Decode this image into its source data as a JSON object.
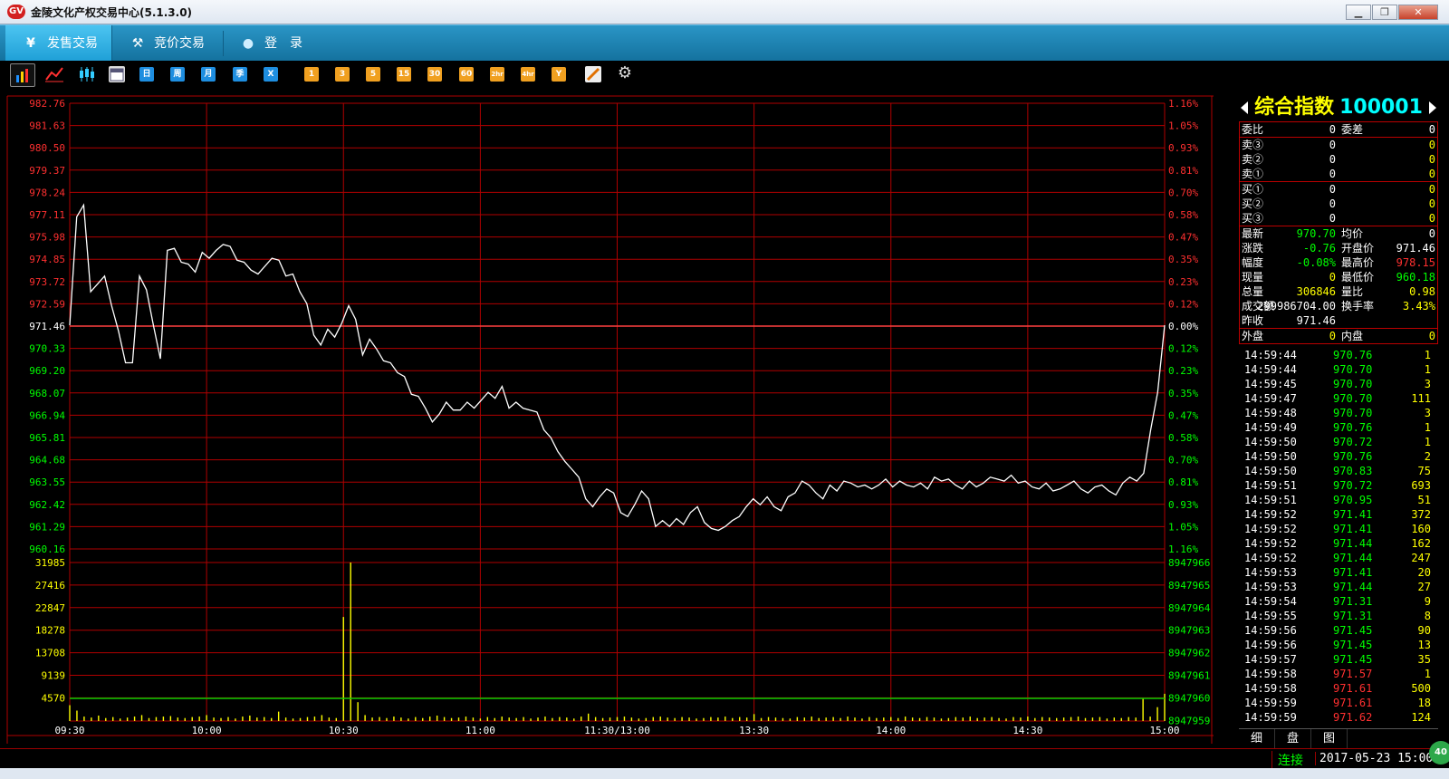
{
  "window": {
    "title": "金陵文化产权交易中心(5.1.3.0)",
    "logo": "GV",
    "min": "▁",
    "max": "❐",
    "close": "✕"
  },
  "nav": {
    "tabs": [
      {
        "label": "发售交易",
        "icon": "yen-icon",
        "glyph": "¥"
      },
      {
        "label": "竞价交易",
        "icon": "gavel-icon",
        "glyph": "⚒"
      },
      {
        "label": "登　录",
        "icon": "user-icon",
        "glyph": "●"
      }
    ]
  },
  "toolbar": {
    "period_buttons": [
      "日",
      "周",
      "月",
      "季",
      "X"
    ],
    "minute_buttons": [
      "1",
      "3",
      "5",
      "15",
      "30",
      "60",
      "2hr",
      "4hr",
      "Y"
    ]
  },
  "chart_data": {
    "type": "line",
    "price_axis_left": [
      "982.76",
      "981.63",
      "980.50",
      "979.37",
      "978.24",
      "977.11",
      "975.98",
      "974.85",
      "973.72",
      "972.59",
      "971.46",
      "970.33",
      "969.20",
      "968.07",
      "966.94",
      "965.81",
      "964.68",
      "963.55",
      "962.42",
      "961.29",
      "960.16"
    ],
    "pct_axis_right": [
      "1.16%",
      "1.05%",
      "0.93%",
      "0.81%",
      "0.70%",
      "0.58%",
      "0.47%",
      "0.35%",
      "0.23%",
      "0.12%",
      "0.00%",
      "0.12%",
      "0.23%",
      "0.35%",
      "0.47%",
      "0.58%",
      "0.70%",
      "0.81%",
      "0.93%",
      "1.05%",
      "1.16%"
    ],
    "prev_close": 971.46,
    "ylim": [
      960.16,
      982.76
    ],
    "volume_axis_left": [
      "31985",
      "27416",
      "22847",
      "18278",
      "13708",
      "9139",
      "4570"
    ],
    "volume_axis_right": [
      "8947966",
      "8947965",
      "8947964",
      "8947963",
      "8947962",
      "8947961",
      "8947960",
      "8947959"
    ],
    "vol_max": 31985,
    "vol_ref": 4570,
    "time_labels": [
      "09:30",
      "10:00",
      "10:30",
      "11:00",
      "11:30/13:00",
      "13:30",
      "14:00",
      "14:30",
      "15:00"
    ],
    "price_series": [
      971.5,
      977.0,
      977.6,
      973.2,
      973.6,
      974.0,
      972.5,
      971.2,
      969.6,
      969.6,
      974.0,
      973.3,
      971.5,
      969.8,
      975.3,
      975.4,
      974.7,
      974.6,
      974.2,
      975.2,
      974.9,
      975.3,
      975.6,
      975.5,
      974.8,
      974.7,
      974.3,
      974.1,
      974.5,
      974.9,
      974.8,
      974.0,
      974.1,
      973.2,
      972.6,
      971.0,
      970.5,
      971.3,
      970.9,
      971.6,
      972.5,
      971.8,
      970.0,
      970.8,
      970.3,
      969.7,
      969.6,
      969.1,
      968.9,
      968.0,
      967.9,
      967.3,
      966.6,
      967.0,
      967.6,
      967.2,
      967.2,
      967.6,
      967.3,
      967.7,
      968.1,
      967.8,
      968.4,
      967.3,
      967.6,
      967.3,
      967.2,
      967.1,
      966.2,
      965.8,
      965.1,
      964.6,
      964.2,
      963.8,
      962.7,
      962.3,
      962.8,
      963.2,
      963.0,
      962.0,
      961.8,
      962.4,
      963.1,
      962.7,
      961.3,
      961.6,
      961.3,
      961.7,
      961.4,
      962.0,
      962.3,
      961.5,
      961.2,
      961.1,
      961.3,
      961.6,
      961.8,
      962.3,
      962.7,
      962.4,
      962.8,
      962.3,
      962.1,
      962.8,
      963.0,
      963.6,
      963.4,
      963.0,
      962.7,
      963.4,
      963.1,
      963.6,
      963.5,
      963.3,
      963.4,
      963.2,
      963.4,
      963.7,
      963.3,
      963.6,
      963.4,
      963.3,
      963.5,
      963.2,
      963.8,
      963.6,
      963.7,
      963.4,
      963.2,
      963.6,
      963.3,
      963.5,
      963.8,
      963.7,
      963.6,
      963.9,
      963.5,
      963.6,
      963.3,
      963.2,
      963.5,
      963.1,
      963.2,
      963.4,
      963.6,
      963.2,
      963.0,
      963.3,
      963.4,
      963.1,
      962.9,
      963.5,
      963.8,
      963.6,
      964.0,
      966.2,
      968.1,
      971.5
    ],
    "volume_series": [
      3200,
      2100,
      900,
      700,
      1100,
      600,
      800,
      500,
      700,
      900,
      1200,
      600,
      800,
      900,
      1000,
      700,
      600,
      800,
      900,
      1200,
      700,
      600,
      800,
      500,
      900,
      1100,
      700,
      800,
      600,
      1900,
      700,
      500,
      600,
      800,
      900,
      1200,
      700,
      600,
      21000,
      31985,
      3800,
      1200,
      700,
      800,
      600,
      900,
      700,
      500,
      800,
      600,
      900,
      1100,
      800,
      600,
      700,
      900,
      700,
      500,
      800,
      600,
      900,
      700,
      600,
      800,
      500,
      700,
      900,
      600,
      800,
      700,
      500,
      900,
      1500,
      800,
      600,
      700,
      800,
      900,
      700,
      500,
      600,
      800,
      900,
      700,
      600,
      800,
      700,
      500,
      600,
      800,
      700,
      900,
      600,
      800,
      700,
      1400,
      600,
      800,
      700,
      600,
      500,
      800,
      700,
      900,
      600,
      700,
      800,
      600,
      900,
      700,
      500,
      800,
      600,
      700,
      800,
      600,
      900,
      700,
      600,
      800,
      700,
      500,
      600,
      800,
      700,
      900,
      600,
      700,
      800,
      600,
      500,
      800,
      700,
      900,
      600,
      800,
      700,
      600,
      700,
      800,
      900,
      600,
      700,
      800,
      500,
      700,
      600,
      800,
      700,
      4600,
      900,
      2800,
      5500
    ]
  },
  "panel": {
    "name": "综合指数",
    "code": "100001",
    "order": [
      {
        "l1": "委比",
        "v1": "0",
        "l2": "委差",
        "v2": "0"
      }
    ],
    "sell": [
      {
        "l": "卖③",
        "p": "0",
        "v": "0"
      },
      {
        "l": "卖②",
        "p": "0",
        "v": "0"
      },
      {
        "l": "卖①",
        "p": "0",
        "v": "0"
      }
    ],
    "buy": [
      {
        "l": "买①",
        "p": "0",
        "v": "0"
      },
      {
        "l": "买②",
        "p": "0",
        "v": "0"
      },
      {
        "l": "买③",
        "p": "0",
        "v": "0"
      }
    ],
    "quote": [
      {
        "l1": "最新",
        "v1": "970.70",
        "c1": "g",
        "l2": "均价",
        "v2": "0",
        "c2": "w"
      },
      {
        "l1": "涨跌",
        "v1": "-0.76",
        "c1": "g",
        "l2": "开盘价",
        "v2": "971.46",
        "c2": "w"
      },
      {
        "l1": "幅度",
        "v1": "-0.08%",
        "c1": "g",
        "l2": "最高价",
        "v2": "978.15",
        "c2": "r"
      },
      {
        "l1": "现量",
        "v1": "0",
        "c1": "y",
        "l2": "最低价",
        "v2": "960.18",
        "c2": "g"
      },
      {
        "l1": "总量",
        "v1": "306846",
        "c1": "y",
        "l2": "量比",
        "v2": "0.98",
        "c2": "y"
      },
      {
        "l1": "成交额",
        "v1": "299986704.00",
        "c1": "w",
        "l2": "换手率",
        "v2": "3.43%",
        "c2": "y"
      },
      {
        "l1": "昨收",
        "v1": "971.46",
        "c1": "w",
        "l2": "",
        "v2": "",
        "c2": "w"
      }
    ],
    "outin": {
      "l1": "外盘",
      "v1": "0",
      "l2": "内盘",
      "v2": "0"
    },
    "ticks": [
      {
        "t": "14:59:44",
        "p": "970.76",
        "v": "1",
        "c": "g"
      },
      {
        "t": "14:59:44",
        "p": "970.70",
        "v": "1",
        "c": "g"
      },
      {
        "t": "14:59:45",
        "p": "970.70",
        "v": "3",
        "c": "g"
      },
      {
        "t": "14:59:47",
        "p": "970.70",
        "v": "111",
        "c": "g"
      },
      {
        "t": "14:59:48",
        "p": "970.70",
        "v": "3",
        "c": "g"
      },
      {
        "t": "14:59:49",
        "p": "970.76",
        "v": "1",
        "c": "g"
      },
      {
        "t": "14:59:50",
        "p": "970.72",
        "v": "1",
        "c": "g"
      },
      {
        "t": "14:59:50",
        "p": "970.76",
        "v": "2",
        "c": "g"
      },
      {
        "t": "14:59:50",
        "p": "970.83",
        "v": "75",
        "c": "g"
      },
      {
        "t": "14:59:51",
        "p": "970.72",
        "v": "693",
        "c": "g"
      },
      {
        "t": "14:59:51",
        "p": "970.95",
        "v": "51",
        "c": "g"
      },
      {
        "t": "14:59:52",
        "p": "971.41",
        "v": "372",
        "c": "g"
      },
      {
        "t": "14:59:52",
        "p": "971.41",
        "v": "160",
        "c": "g"
      },
      {
        "t": "14:59:52",
        "p": "971.44",
        "v": "162",
        "c": "g"
      },
      {
        "t": "14:59:52",
        "p": "971.44",
        "v": "247",
        "c": "g"
      },
      {
        "t": "14:59:53",
        "p": "971.41",
        "v": "20",
        "c": "g"
      },
      {
        "t": "14:59:53",
        "p": "971.44",
        "v": "27",
        "c": "g"
      },
      {
        "t": "14:59:54",
        "p": "971.31",
        "v": "9",
        "c": "g"
      },
      {
        "t": "14:59:55",
        "p": "971.31",
        "v": "8",
        "c": "g"
      },
      {
        "t": "14:59:56",
        "p": "971.45",
        "v": "90",
        "c": "g"
      },
      {
        "t": "14:59:56",
        "p": "971.45",
        "v": "13",
        "c": "g"
      },
      {
        "t": "14:59:57",
        "p": "971.45",
        "v": "35",
        "c": "g"
      },
      {
        "t": "14:59:58",
        "p": "971.57",
        "v": "1",
        "c": "r"
      },
      {
        "t": "14:59:58",
        "p": "971.61",
        "v": "500",
        "c": "r"
      },
      {
        "t": "14:59:59",
        "p": "971.61",
        "v": "18",
        "c": "r"
      },
      {
        "t": "14:59:59",
        "p": "971.62",
        "v": "124",
        "c": "r"
      }
    ],
    "tabs": [
      "细",
      "盘",
      "图"
    ]
  },
  "status": {
    "connection": "连接",
    "datetime": "2017-05-23 15:00",
    "badge": "40"
  },
  "colors": {
    "up": "#ff3030",
    "down": "#00ff00",
    "grid": "#b00000",
    "price_line": "#ffffff",
    "volume": "#ffff00",
    "ref_line": "#00cc00"
  }
}
